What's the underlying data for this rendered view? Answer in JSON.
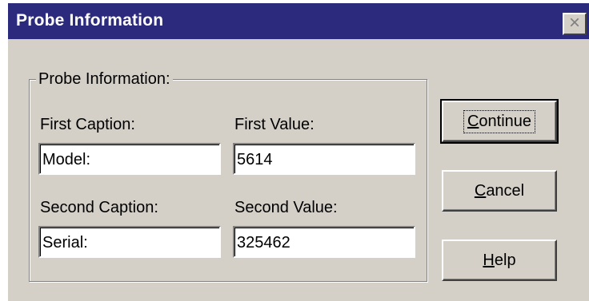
{
  "window": {
    "title": "Probe Information",
    "close_glyph": "×"
  },
  "group": {
    "title": "Probe Information:"
  },
  "fields": {
    "first_caption_label": "First Caption:",
    "first_caption_value": "Model:",
    "first_value_label": "First Value:",
    "first_value_value": "5614",
    "second_caption_label": "Second Caption:",
    "second_caption_value": "Serial:",
    "second_value_label": "Second Value:",
    "second_value_value": "325462"
  },
  "buttons": {
    "continue_mnemonic": "C",
    "continue_rest": "ontinue",
    "cancel_mnemonic": "C",
    "cancel_rest": "ancel",
    "help_mnemonic": "H",
    "help_rest": "elp"
  },
  "colors": {
    "titlebar": "#2c2a7c",
    "dialog_face": "#d4d0c8"
  }
}
